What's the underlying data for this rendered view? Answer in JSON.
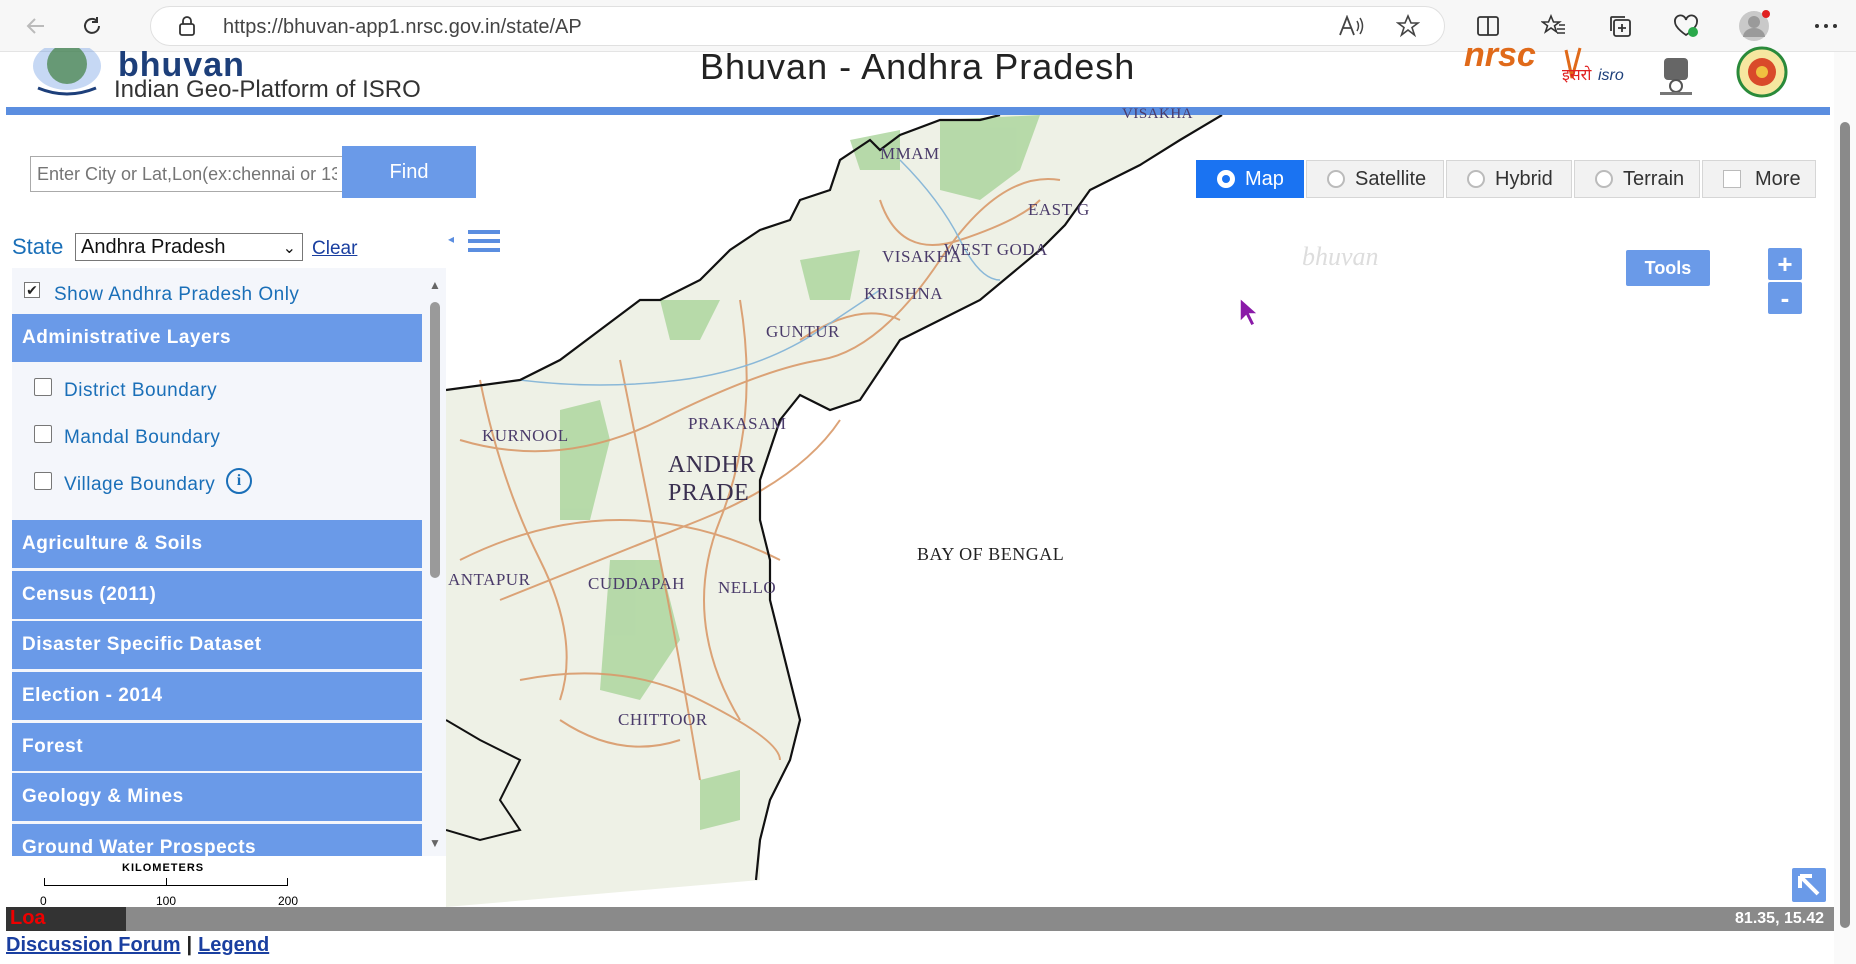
{
  "browser": {
    "url": "https://bhuvan-app1.nrsc.gov.in/state/AP"
  },
  "header": {
    "brand": "bhuvan",
    "subtitle": "Indian Geo-Platform of ISRO",
    "title": "Bhuvan - Andhra Pradesh"
  },
  "search": {
    "placeholder": "Enter City or Lat,Lon(ex:chennai or 13",
    "find_label": "Find"
  },
  "state": {
    "label": "State",
    "selected": "Andhra Pradesh",
    "clear_label": "Clear"
  },
  "layers": {
    "show_only_label": "Show Andhra Pradesh Only",
    "show_only_checked": true,
    "admin_title": "Administrative Layers",
    "admin_items": [
      {
        "label": "District Boundary"
      },
      {
        "label": "Mandal Boundary"
      },
      {
        "label": "Village Boundary"
      }
    ],
    "categories": [
      "Agriculture & Soils",
      "Census (2011)",
      "Disaster Specific Dataset",
      "Election - 2014",
      "Forest",
      "Geology & Mines",
      "Ground Water Prospects"
    ]
  },
  "map_types": {
    "map": "Map",
    "satellite": "Satellite",
    "hybrid": "Hybrid",
    "terrain": "Terrain",
    "more": "More",
    "active": "Map"
  },
  "tools_label": "Tools",
  "zoom": {
    "in": "+",
    "out": "-"
  },
  "watermark": "bhuvan",
  "map_labels": {
    "khammam": "MMAM",
    "visakha": "VISAKHA",
    "east_godavari": "EAST G",
    "west_godavari": "WEST GODA",
    "krishna": "KRISHNA",
    "guntur": "GUNTUR",
    "prakasam": "PRAKASAM",
    "kurnool": "KURNOOL",
    "andhra": "ANDHR",
    "pradesh": "PRADE",
    "anantapur": "ANTAPUR",
    "cuddapah": "CUDDAPAH",
    "nellore": "NELLO",
    "chittoor": "CHITTOOR",
    "sea": "BAY OF BENGAL"
  },
  "scale": {
    "unit": "KILOMETERS",
    "ticks": [
      "0",
      "100",
      "200"
    ]
  },
  "status": {
    "loading": "Loa",
    "coords": "81.35, 15.42"
  },
  "footer": {
    "forum": "Discussion Forum",
    "separator": "|",
    "legend": "Legend"
  },
  "colors": {
    "accent": "#6a9ae8",
    "active_tab": "#1a73f2",
    "link": "#1a6fb8"
  }
}
